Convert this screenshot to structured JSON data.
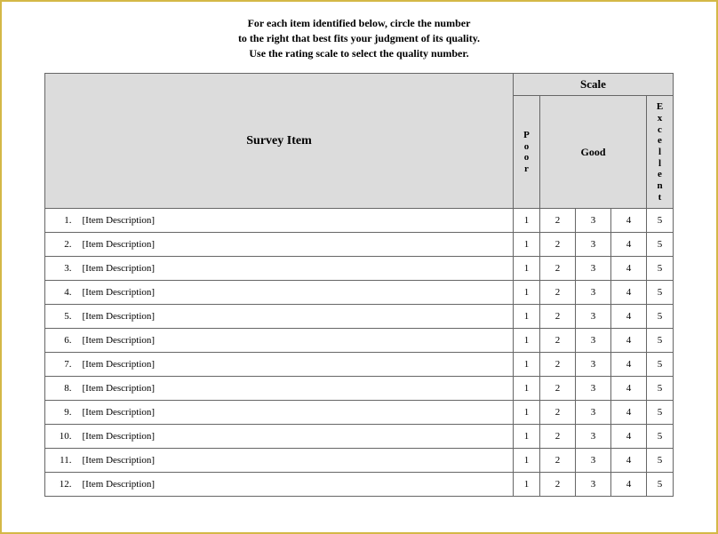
{
  "instructions": {
    "line1": "For each item identified below, circle the number",
    "line2": "to the right that best fits your judgment of its quality.",
    "line3": "Use the rating scale to select the quality number."
  },
  "headers": {
    "survey_item": "Survey Item",
    "scale": "Scale",
    "poor": "Poor",
    "good": "Good",
    "excellent": "Excellent"
  },
  "rating_values": [
    "1",
    "2",
    "3",
    "4",
    "5"
  ],
  "rows": [
    {
      "num": "1.",
      "desc": "[Item Description]"
    },
    {
      "num": "2.",
      "desc": "[Item Description]"
    },
    {
      "num": "3.",
      "desc": "[Item Description]"
    },
    {
      "num": "4.",
      "desc": "[Item Description]"
    },
    {
      "num": "5.",
      "desc": "[Item Description]"
    },
    {
      "num": "6.",
      "desc": "[Item Description]"
    },
    {
      "num": "7.",
      "desc": "[Item Description]"
    },
    {
      "num": "8.",
      "desc": "[Item Description]"
    },
    {
      "num": "9.",
      "desc": "[Item Description]"
    },
    {
      "num": "10.",
      "desc": "[Item Description]"
    },
    {
      "num": "11.",
      "desc": "[Item Description]"
    },
    {
      "num": "12.",
      "desc": "[Item Description]"
    }
  ]
}
